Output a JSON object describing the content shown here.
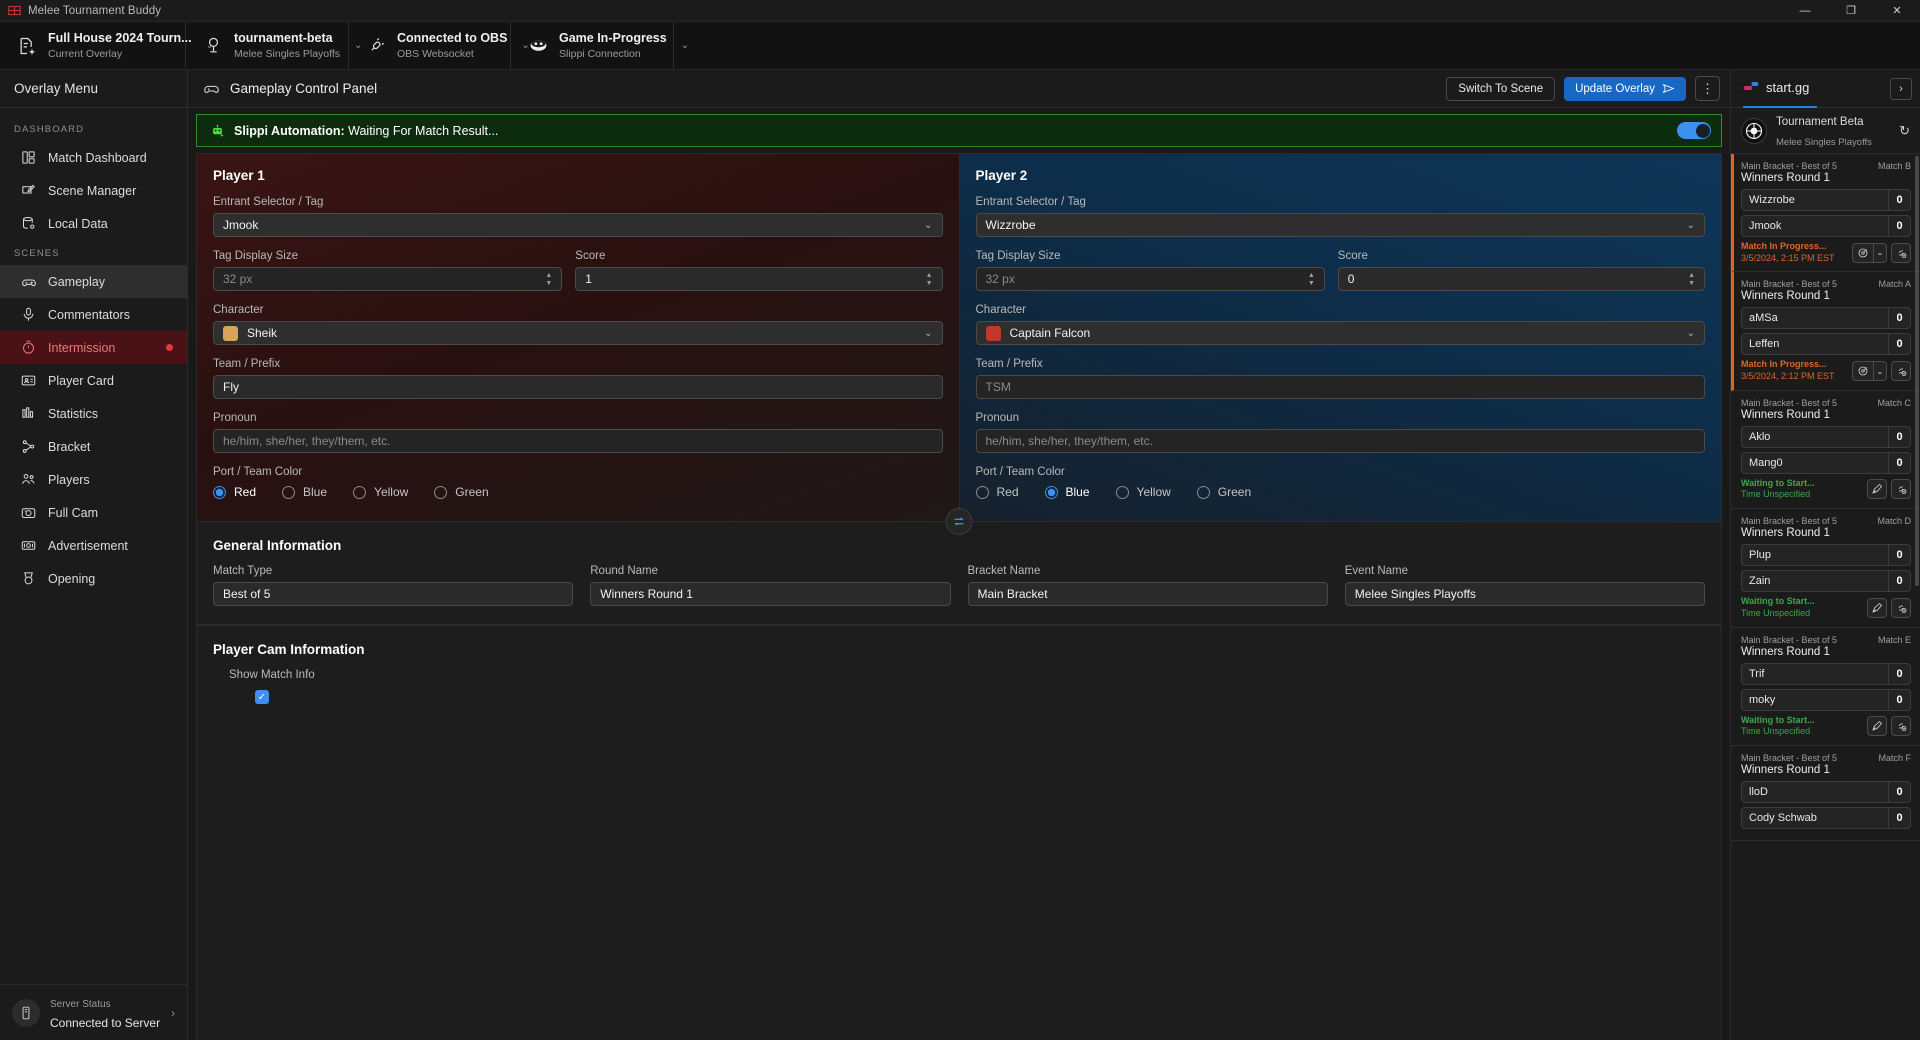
{
  "window": {
    "title": "Melee Tournament Buddy",
    "minimize": "—",
    "maximize": "❐",
    "close": "✕"
  },
  "topbar": {
    "cards": [
      {
        "icon": "overlay-doc-icon",
        "primary": "Full House 2024 Tourn...",
        "secondary": "Current Overlay"
      },
      {
        "icon": "trophy-icon",
        "primary": "tournament-beta",
        "secondary": "Melee Singles Playoffs"
      },
      {
        "icon": "plug-icon",
        "primary": "Connected to OBS",
        "secondary": "OBS Websocket"
      },
      {
        "icon": "slippi-icon",
        "primary": "Game In-Progress",
        "secondary": "Slippi Connection"
      }
    ]
  },
  "sidebar": {
    "header": "Overlay Menu",
    "groups": [
      {
        "label": "DASHBOARD",
        "items": [
          {
            "label": "Match Dashboard",
            "icon": "dashboard-icon",
            "state": "normal"
          },
          {
            "label": "Scene Manager",
            "icon": "scene-edit-icon",
            "state": "normal"
          },
          {
            "label": "Local Data",
            "icon": "database-icon",
            "state": "normal"
          }
        ]
      },
      {
        "label": "SCENES",
        "items": [
          {
            "label": "Gameplay",
            "icon": "gamepad-icon",
            "state": "active"
          },
          {
            "label": "Commentators",
            "icon": "microphone-icon",
            "state": "normal"
          },
          {
            "label": "Intermission",
            "icon": "timer-icon",
            "state": "alert"
          },
          {
            "label": "Player Card",
            "icon": "id-card-icon",
            "state": "normal"
          },
          {
            "label": "Statistics",
            "icon": "bar-chart-icon",
            "state": "normal"
          },
          {
            "label": "Bracket",
            "icon": "bracket-icon",
            "state": "normal"
          },
          {
            "label": "Players",
            "icon": "people-icon",
            "state": "normal"
          },
          {
            "label": "Full Cam",
            "icon": "camera-icon",
            "state": "normal"
          },
          {
            "label": "Advertisement",
            "icon": "money-icon",
            "state": "normal"
          },
          {
            "label": "Opening",
            "icon": "medal-icon",
            "state": "normal"
          }
        ]
      }
    ],
    "footer": {
      "icon": "server-icon",
      "label": "Server Status",
      "value": "Connected to Server",
      "chevron": "›"
    }
  },
  "control_panel": {
    "icon": "gamepad-icon",
    "title": "Gameplay Control Panel",
    "switch_scene_label": "Switch To Scene",
    "update_overlay_label": "Update Overlay",
    "update_overlay_icon": "send-icon",
    "kebab_label": "⋮"
  },
  "automation": {
    "icon": "robot-icon",
    "prefix": "Slippi Automation:",
    "message": "Waiting For Match Result...",
    "toggle_on": true
  },
  "player1": {
    "heading": "Player 1",
    "entrant_label": "Entrant Selector / Tag",
    "entrant_value": "Jmook",
    "tag_size_label": "Tag Display Size",
    "tag_size_placeholder": "32 px",
    "score_label": "Score",
    "score_value": "1",
    "character_label": "Character",
    "character_value": "Sheik",
    "character_color": "#d8a45a",
    "team_label": "Team / Prefix",
    "team_value": "Fly",
    "pronoun_label": "Pronoun",
    "pronoun_placeholder": "he/him, she/her, they/them, etc.",
    "port_label": "Port / Team Color",
    "colors": [
      "Red",
      "Blue",
      "Yellow",
      "Green"
    ],
    "selected_color": "Red"
  },
  "player2": {
    "heading": "Player 2",
    "entrant_label": "Entrant Selector / Tag",
    "entrant_value": "Wizzrobe",
    "tag_size_label": "Tag Display Size",
    "tag_size_placeholder": "32 px",
    "score_label": "Score",
    "score_value": "0",
    "character_label": "Character",
    "character_value": "Captain Falcon",
    "character_color": "#c0392b",
    "team_label": "Team / Prefix",
    "team_placeholder": "TSM",
    "pronoun_label": "Pronoun",
    "pronoun_placeholder": "he/him, she/her, they/them, etc.",
    "port_label": "Port / Team Color",
    "colors": [
      "Red",
      "Blue",
      "Yellow",
      "Green"
    ],
    "selected_color": "Blue"
  },
  "swap_button_icon": "swap-icon",
  "general_information": {
    "heading": "General Information",
    "fields": [
      {
        "label": "Match Type",
        "value": "Best of 5"
      },
      {
        "label": "Round Name",
        "value": "Winners Round 1"
      },
      {
        "label": "Bracket Name",
        "value": "Main Bracket"
      },
      {
        "label": "Event Name",
        "value": "Melee Singles Playoffs"
      }
    ]
  },
  "player_cam": {
    "heading": "Player Cam Information",
    "show_match_info_label": "Show Match Info",
    "show_match_info_checked": true,
    "check_glyph": "✓"
  },
  "startgg": {
    "tab_label": "start.gg",
    "tab_icon": "startgg-logo-icon",
    "expand_icon": "›",
    "tournament_name": "Tournament Beta",
    "tournament_event": "Melee Singles Playoffs",
    "refresh_icon": "↻",
    "matches": [
      {
        "bracket": "Main Bracket - Best of 5",
        "match_id": "Match B",
        "round": "Winners Round 1",
        "p1": "Wizzrobe",
        "p1_score": "0",
        "p2": "Jmook",
        "p2_score": "0",
        "status": "Match In Progress...",
        "time": "3/5/2024, 2:15 PM EST",
        "state": "prog",
        "actions": [
          "report-split-icon",
          "link-add-icon"
        ]
      },
      {
        "bracket": "Main Bracket - Best of 5",
        "match_id": "Match A",
        "round": "Winners Round 1",
        "p1": "aMSa",
        "p1_score": "0",
        "p2": "Leffen",
        "p2_score": "0",
        "status": "Match In Progress...",
        "time": "3/5/2024, 2:12 PM EST",
        "state": "prog",
        "actions": [
          "report-split-icon",
          "link-add-icon"
        ]
      },
      {
        "bracket": "Main Bracket - Best of 5",
        "match_id": "Match C",
        "round": "Winners Round 1",
        "p1": "Aklo",
        "p1_score": "0",
        "p2": "Mang0",
        "p2_score": "0",
        "status": "Waiting to Start...",
        "time": "Time Unspecified",
        "state": "wait",
        "actions": [
          "start-icon",
          "link-add-icon"
        ]
      },
      {
        "bracket": "Main Bracket - Best of 5",
        "match_id": "Match D",
        "round": "Winners Round 1",
        "p1": "Plup",
        "p1_score": "0",
        "p2": "Zain",
        "p2_score": "0",
        "status": "Waiting to Start...",
        "time": "Time Unspecified",
        "state": "wait",
        "actions": [
          "start-icon",
          "link-add-icon"
        ]
      },
      {
        "bracket": "Main Bracket - Best of 5",
        "match_id": "Match E",
        "round": "Winners Round 1",
        "p1": "Trif",
        "p1_score": "0",
        "p2": "moky",
        "p2_score": "0",
        "status": "Waiting to Start...",
        "time": "Time Unspecified",
        "state": "wait",
        "actions": [
          "start-icon",
          "link-add-icon"
        ]
      },
      {
        "bracket": "Main Bracket - Best of 5",
        "match_id": "Match F",
        "round": "Winners Round 1",
        "p1": "lloD",
        "p1_score": "0",
        "p2": "Cody Schwab",
        "p2_score": "0",
        "status": "",
        "time": "",
        "state": "wait",
        "actions": []
      }
    ]
  },
  "colors": {
    "accent": "#1668c4",
    "alert": "#e03b3b",
    "live": "#e0642a",
    "waiting": "#3ea64e",
    "toggle": "#3b90f0"
  }
}
